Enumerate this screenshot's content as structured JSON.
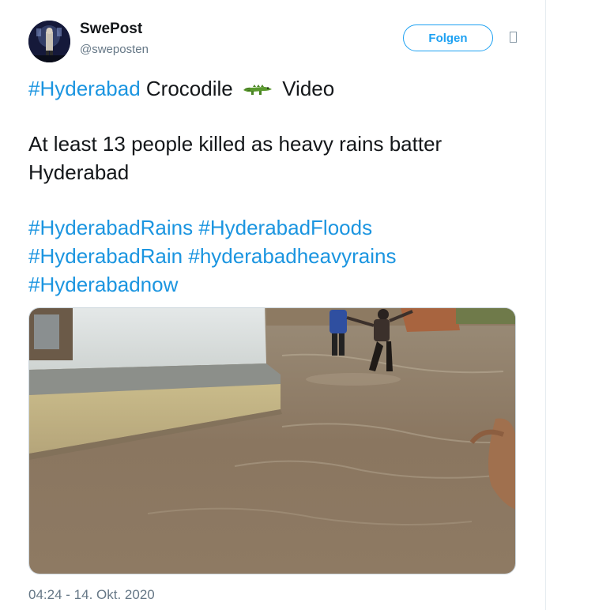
{
  "user": {
    "display_name": "SwePost",
    "handle": "@sweposten"
  },
  "follow_button": {
    "label": "Folgen"
  },
  "menu": {
    "icon": "chevron-down-icon"
  },
  "tweet": {
    "line1": {
      "hashtag": "#Hyderabad",
      "text_before_emoji": "Crocodile",
      "emoji": "crocodile-icon",
      "text_after_emoji": "Video"
    },
    "headline_line1": "At least 13 people killed as heavy rains batter",
    "headline_line2": "Hyderabad",
    "hashtags": [
      "#HyderabadRains",
      "#HyderabadFloods",
      "#HyderabadRain",
      "#hyderabadheavyrains",
      "#Hyderabadnow"
    ]
  },
  "media": {
    "type": "video-thumbnail",
    "description_icon": "flood-video-thumbnail"
  },
  "timestamp": {
    "time": "04:24",
    "separator": " - ",
    "date": "14. Okt. 2020"
  },
  "colors": {
    "link": "#1b95e0",
    "follow_border": "#1da1f2",
    "text": "#14171a",
    "secondary_text": "#657786"
  }
}
